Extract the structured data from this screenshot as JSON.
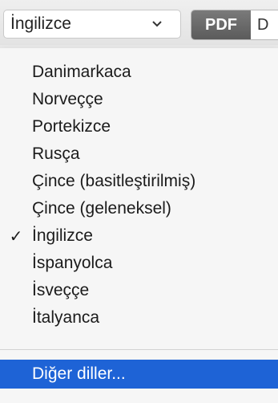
{
  "toolbar": {
    "language_select": {
      "value": "İngilizce",
      "chevron_icon": "chevron-down-icon"
    },
    "format_segments": [
      {
        "label": "PDF",
        "active": true
      },
      {
        "label": "D",
        "active": false
      }
    ]
  },
  "menu": {
    "items": [
      {
        "label": "Danimarkaca",
        "checked": false
      },
      {
        "label": "Norveççe",
        "checked": false
      },
      {
        "label": "Portekizce",
        "checked": false
      },
      {
        "label": "Rusça",
        "checked": false
      },
      {
        "label": "Çince (basitleştirilmiş)",
        "checked": false
      },
      {
        "label": "Çince (geleneksel)",
        "checked": false
      },
      {
        "label": "İngilizce",
        "checked": true,
        "check_mark": "✓"
      },
      {
        "label": "İspanyolca",
        "checked": false
      },
      {
        "label": "İsveççe",
        "checked": false
      },
      {
        "label": "İtalyanca",
        "checked": false
      }
    ],
    "more_item": {
      "label": "Diğer diller...",
      "highlighted": true
    }
  },
  "colors": {
    "highlight": "#1e63d6",
    "segment_active": "#5b5b5b"
  }
}
